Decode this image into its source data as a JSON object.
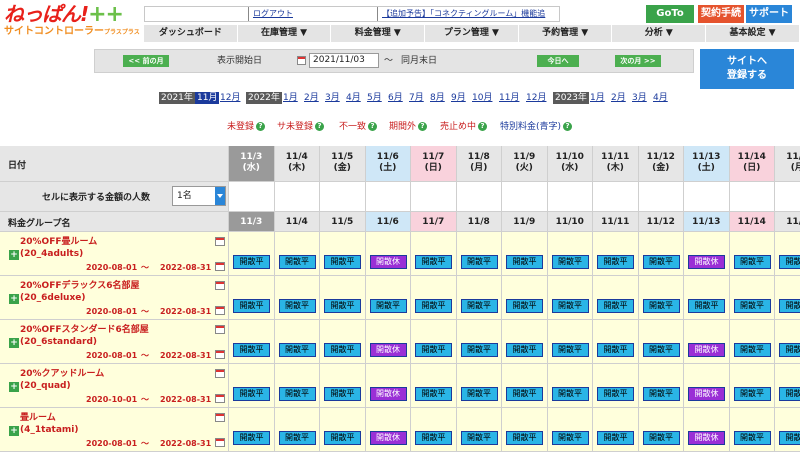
{
  "logo": {
    "line1": "ねっぱん!",
    "plus": "++",
    "line2": "サイトコントローラー",
    "line2_small": "プラスプラス"
  },
  "news": {
    "logout": "ログアウト",
    "notice": "【追加予告】「コネクティングルーム」機能追"
  },
  "top_buttons": {
    "goto": "GoTo",
    "contract": "契約手続",
    "support": "サポート"
  },
  "nav": [
    "ダッシュボード",
    "在庫管理 ▼",
    "料金管理 ▼",
    "プラン管理 ▼",
    "予約管理 ▼",
    "分析 ▼",
    "基本設定 ▼"
  ],
  "date_control": {
    "prev_month": "<< 前の月",
    "start_label": "表示開始日",
    "start_date": "2021/11/03",
    "tilde": "〜",
    "end_label": "同月末日",
    "today": "今日へ",
    "next_month": "次の月 >>"
  },
  "register_button": {
    "line1": "サイトへ",
    "line2": "登録する"
  },
  "months": {
    "y2021": "2021年",
    "m2021": [
      "11月",
      "12月"
    ],
    "y2022": "2022年",
    "m2022": [
      "1月",
      "2月",
      "3月",
      "4月",
      "5月",
      "6月",
      "7月",
      "8月",
      "9月",
      "10月",
      "11月",
      "12月"
    ],
    "y2023": "2023年",
    "m2023": [
      "1月",
      "2月",
      "3月",
      "4月"
    ]
  },
  "legend": {
    "unregistered": "未登録",
    "site_unregistered": "サ未登録",
    "mismatch": "不一致",
    "out_of_period": "期間外",
    "sold_out": "売止め中",
    "special": "特別料金(青字)",
    "help": "?"
  },
  "colors": {
    "accent_red": "#c81e1e",
    "status_open": "#2ab5e6",
    "status_closed": "#9a2fd6",
    "link_blue": "#1b3a9c"
  },
  "grid": {
    "date_header": "日付",
    "people_label": "セルに表示する金額の人数",
    "people_select": "1名",
    "group_header": "料金グループ名",
    "dates": [
      {
        "d": "11/3",
        "w": "(水)",
        "kind": "today"
      },
      {
        "d": "11/4",
        "w": "(木)",
        "kind": ""
      },
      {
        "d": "11/5",
        "w": "(金)",
        "kind": ""
      },
      {
        "d": "11/6",
        "w": "(土)",
        "kind": "sat"
      },
      {
        "d": "11/7",
        "w": "(日)",
        "kind": "sun"
      },
      {
        "d": "11/8",
        "w": "(月)",
        "kind": ""
      },
      {
        "d": "11/9",
        "w": "(火)",
        "kind": ""
      },
      {
        "d": "11/10",
        "w": "(水)",
        "kind": ""
      },
      {
        "d": "11/11",
        "w": "(木)",
        "kind": ""
      },
      {
        "d": "11/12",
        "w": "(金)",
        "kind": ""
      },
      {
        "d": "11/13",
        "w": "(土)",
        "kind": "sat"
      },
      {
        "d": "11/14",
        "w": "(日)",
        "kind": "sun"
      },
      {
        "d": "11/1",
        "w": "(月",
        "kind": ""
      }
    ],
    "status_labels": {
      "open": "開散平",
      "closed": "開散休"
    },
    "plans": [
      {
        "name": "20%OFF畳ルーム",
        "code": "(20_4adults)",
        "start": "2020-08-01",
        "end": "2022-08-31",
        "statuses": [
          "open",
          "open",
          "open",
          "closed",
          "open",
          "open",
          "open",
          "open",
          "open",
          "open",
          "closed",
          "open",
          "open"
        ]
      },
      {
        "name": "20%OFFデラックス6名部屋",
        "code": "(20_6deluxe)",
        "start": "2020-08-01",
        "end": "2022-08-31",
        "statuses": [
          "open",
          "open",
          "open",
          "open",
          "open",
          "open",
          "open",
          "open",
          "open",
          "open",
          "open",
          "open",
          "open"
        ]
      },
      {
        "name": "20%OFFスタンダード6名部屋",
        "code": "(20_6standard)",
        "start": "2020-08-01",
        "end": "2022-08-31",
        "statuses": [
          "open",
          "open",
          "open",
          "closed",
          "open",
          "open",
          "open",
          "open",
          "open",
          "open",
          "closed",
          "open",
          "open"
        ]
      },
      {
        "name": "20%クアッドルーム",
        "code": "(20_quad)",
        "start": "2020-10-01",
        "end": "2022-08-31",
        "statuses": [
          "open",
          "open",
          "open",
          "closed",
          "open",
          "open",
          "open",
          "open",
          "open",
          "open",
          "closed",
          "open",
          "open"
        ]
      },
      {
        "name": "畳ルーム",
        "code": "(4_1tatami)",
        "start": "2020-08-01",
        "end": "2022-08-31",
        "statuses": [
          "open",
          "open",
          "open",
          "closed",
          "open",
          "open",
          "open",
          "open",
          "open",
          "open",
          "closed",
          "open",
          "open"
        ]
      }
    ]
  }
}
